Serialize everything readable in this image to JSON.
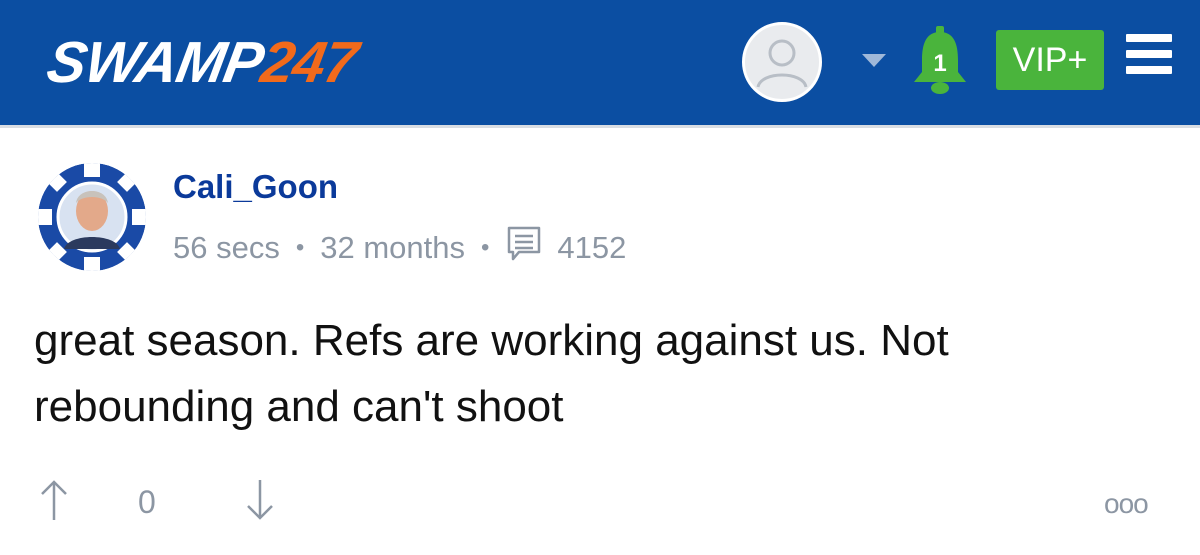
{
  "header": {
    "logo_main": "SWAMP",
    "logo_number": "247",
    "notification_count": "1",
    "vip_label": "VIP+",
    "colors": {
      "background": "#0b4ea2",
      "vip": "#4ab43c",
      "bell": "#4ab43c",
      "logo_accent": "#f26a1b"
    }
  },
  "post": {
    "username": "Cali_Goon",
    "posted_ago": "56 secs",
    "member_for": "32 months",
    "message_count": "4152",
    "separator": "•",
    "body": "great season. Refs are working against us. Not rebounding and can't shoot"
  },
  "actions": {
    "vote_count": "0",
    "more_label": "ooo",
    "icons": [
      "arrow-up-icon",
      "arrow-down-icon",
      "more-icon"
    ]
  }
}
